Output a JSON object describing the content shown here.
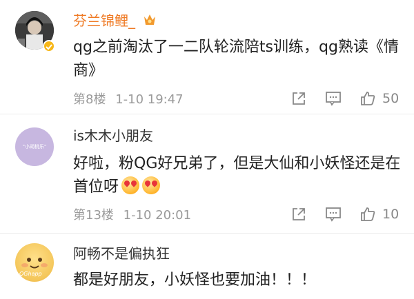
{
  "comments": [
    {
      "username": "芬兰锦鲤_",
      "username_color": "#ef7a24",
      "text": "qg之前淘汰了一二队轮流陪ts训练，qg熟读《情商》",
      "floor": "第8楼",
      "time": "1-10 19:47",
      "likes": "50",
      "avatar_icon": "avatar-photo-icon",
      "badge_icon": "vip-crown-icon"
    },
    {
      "username": "is木木小朋友",
      "username_color": "#333333",
      "text": "好啦，粉QG好兄弟了，但是大仙和小妖怪还是在首位呀",
      "floor": "第13楼",
      "time": "1-10 20:01",
      "likes": "10",
      "avatar_text": "\"小胡桃乐\""
    },
    {
      "username": "阿畅不是偏执狂",
      "username_color": "#333333",
      "text": "都是好朋友，小妖怪也要加油！！！",
      "avatar_text": "QGhapp"
    }
  ],
  "colors": {
    "accent_orange": "#ef7a24",
    "meta_gray": "#9a9a9a",
    "avatar_lavender": "#c7b7e0",
    "avatar_yellow": "#f4c65a"
  }
}
